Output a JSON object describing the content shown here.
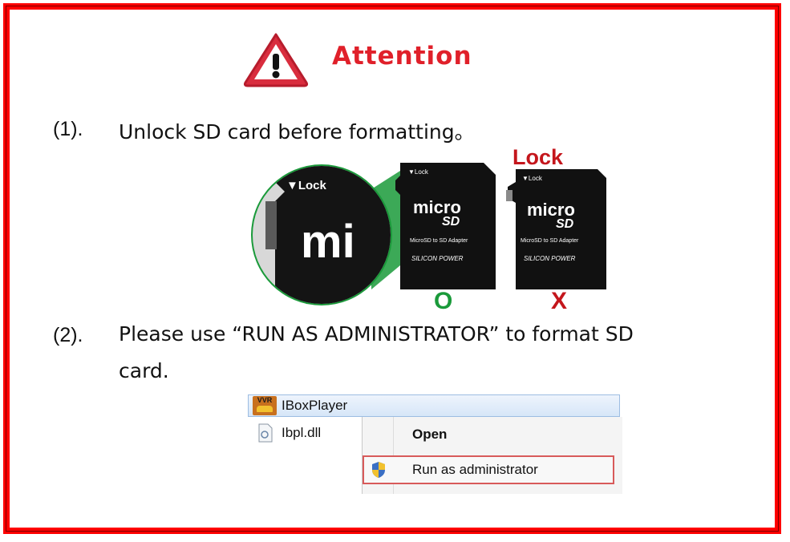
{
  "title": "Attention",
  "items": [
    {
      "num": "(1).",
      "text": "Unlock SD card before formatting。"
    },
    {
      "num": "(2).",
      "text_line1": "Please use “RUN AS ADMINISTRATOR” to format SD",
      "text_line2": "card."
    }
  ],
  "sd_illustration": {
    "lock_heading": "Lock",
    "zoom_label": "▼Lock",
    "zoom_logo": "mi",
    "cards": [
      {
        "lock_label": "▼Lock",
        "logo_top": "micro",
        "logo_bottom": "SD",
        "adapter": "MicroSD to SD Adapter",
        "brand": "SILICON POWER",
        "mark": "O",
        "mark_color": "#1a9a3a"
      },
      {
        "lock_label": "▼Lock",
        "logo_top": "micro",
        "logo_bottom": "SD",
        "adapter": "MicroSD to SD Adapter",
        "brand": "SILICON POWER",
        "mark": "X",
        "mark_color": "#c4161c"
      }
    ]
  },
  "context_menu": {
    "file1": "IBoxPlayer",
    "file1_badge": "VVR",
    "file2": "Ibpl.dll",
    "open_label": "Open",
    "run_admin_label": "Run as administrator"
  },
  "colors": {
    "border": "#ff0000",
    "title": "#e0202a",
    "warning_icon": "#d92d3e"
  }
}
